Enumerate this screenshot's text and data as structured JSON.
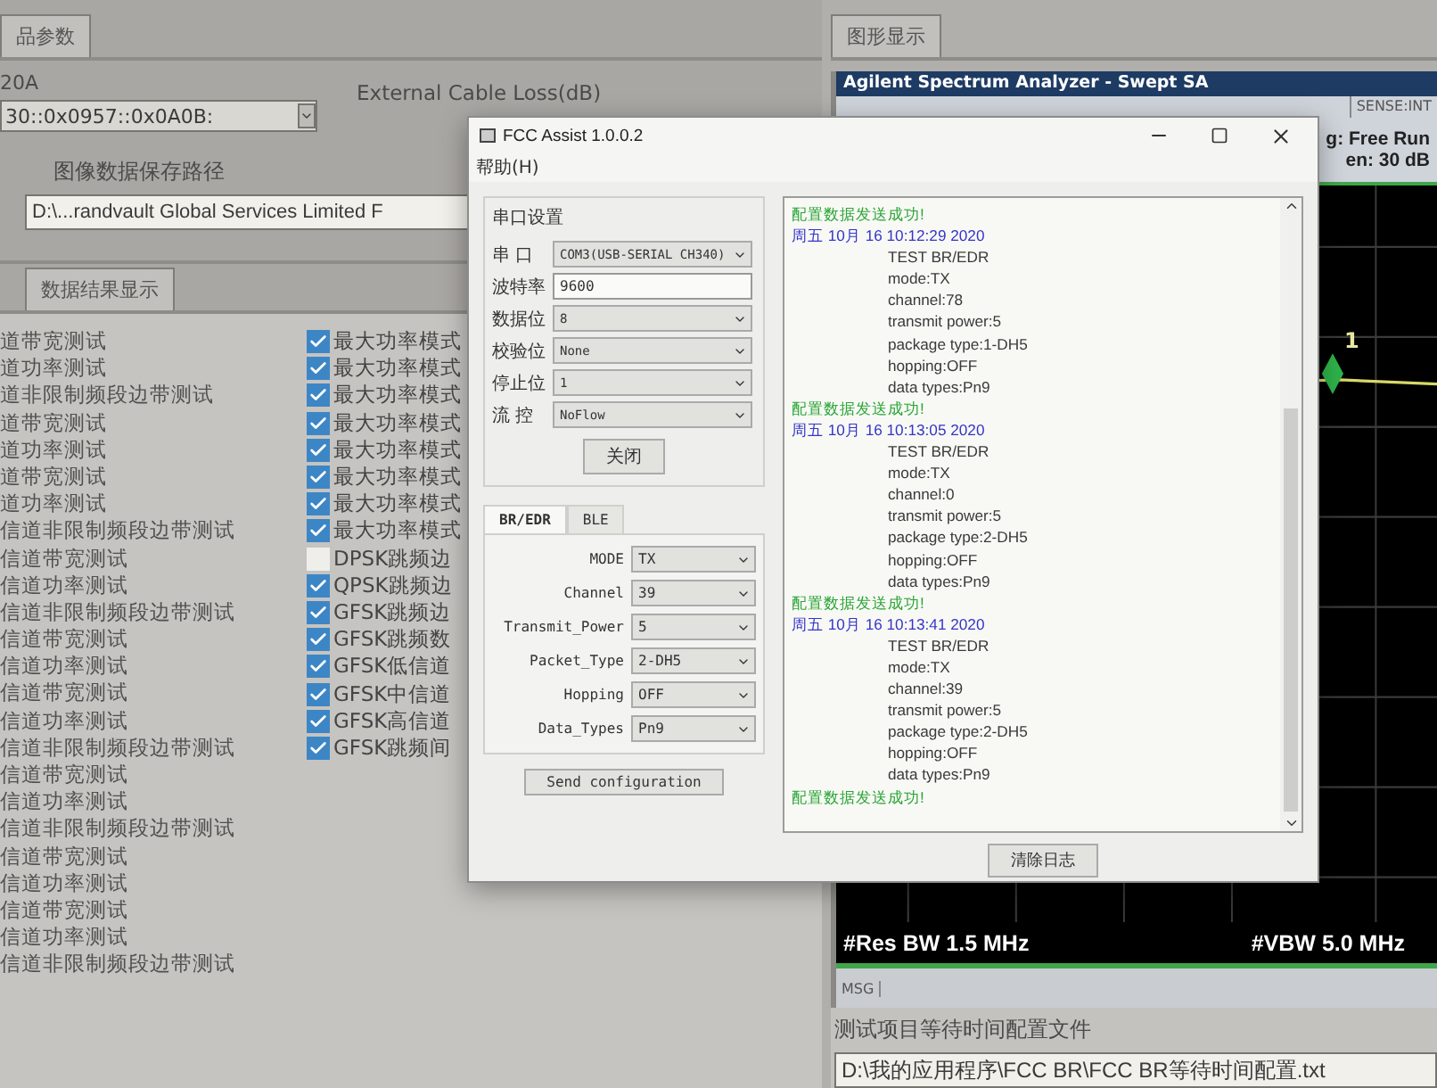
{
  "main_window": {
    "left_tab": "品参数",
    "device_id": "20A",
    "address_combo": "30::0x0957::0x0A0B:",
    "cable_loss_label": "External Cable Loss(dB)",
    "image_path_label": "图像数据保存路径",
    "image_path": "D:\\...randvault Global Services Limited F",
    "results_tab": "数据结果显示",
    "test_items": [
      "道带宽测试",
      "道功率测试",
      "道非限制频段边带测试",
      "道带宽测试",
      "道功率测试",
      "道带宽测试",
      "道功率测试",
      "信道非限制频段边带测试",
      "信道带宽测试",
      "信道功率测试",
      "信道非限制频段边带测试",
      "信道带宽测试",
      "信道功率测试",
      "信道带宽测试",
      "信道功率测试",
      "信道非限制频段边带测试",
      "信道带宽测试",
      "信道功率测试",
      "信道非限制频段边带测试",
      "信道带宽测试",
      "信道功率测试",
      "信道带宽测试",
      "信道功率测试",
      "信道非限制频段边带测试"
    ],
    "modes": [
      {
        "label": "最大功率模式",
        "checked": true
      },
      {
        "label": "最大功率模式",
        "checked": true
      },
      {
        "label": "最大功率模式",
        "checked": true
      },
      {
        "label": "最大功率模式",
        "checked": true
      },
      {
        "label": "最大功率模式",
        "checked": true
      },
      {
        "label": "最大功率模式",
        "checked": true
      },
      {
        "label": "最大功率模式",
        "checked": true
      },
      {
        "label": "最大功率模式",
        "checked": true
      },
      {
        "label": "DPSK跳频边",
        "checked": false
      },
      {
        "label": "QPSK跳频边",
        "checked": true
      },
      {
        "label": "GFSK跳频边",
        "checked": true
      },
      {
        "label": "GFSK跳频数",
        "checked": true
      },
      {
        "label": "GFSK低信道",
        "checked": true
      },
      {
        "label": "GFSK中信道",
        "checked": true
      },
      {
        "label": "GFSK高信道",
        "checked": true
      },
      {
        "label": "GFSK跳频间",
        "checked": true
      }
    ],
    "graph_tab": "图形显示",
    "analyzer": {
      "title": "Agilent Spectrum Analyzer - Swept SA",
      "sense": "SENSE:INT",
      "trigger": "g: Free Run",
      "atten": "en: 30 dB",
      "marker": "1",
      "res_bw": "#Res BW 1.5 MHz",
      "vbw": "#VBW 5.0 MHz",
      "msg": "MSG"
    },
    "wait_config_label": "测试项目等待时间配置文件",
    "wait_config_path": "D:\\我的应用程序\\FCC BR\\FCC BR等待时间配置.txt"
  },
  "dialog": {
    "title": "FCC Assist 1.0.0.2",
    "menu": "帮助(H)",
    "serial_group": "串口设置",
    "serial_fields": [
      {
        "kind": "select",
        "label": "串 口",
        "value": "COM3(USB-SERIAL CH340)"
      },
      {
        "kind": "input",
        "label": "波特率",
        "value": "9600"
      },
      {
        "kind": "select",
        "label": "数据位",
        "value": "8"
      },
      {
        "kind": "select",
        "label": "校验位",
        "value": "None"
      },
      {
        "kind": "select",
        "label": "停止位",
        "value": "1"
      },
      {
        "kind": "select",
        "label": "流 控",
        "value": "NoFlow"
      }
    ],
    "close_button": "关闭",
    "tabs": [
      {
        "label": "BR/EDR",
        "selected": true
      },
      {
        "label": "BLE",
        "selected": false
      }
    ],
    "config_fields": [
      {
        "label": "MODE",
        "value": "TX"
      },
      {
        "label": "Channel",
        "value": "39"
      },
      {
        "label": "Transmit_Power",
        "value": "5"
      },
      {
        "label": "Packet_Type",
        "value": "2-DH5"
      },
      {
        "label": "Hopping",
        "value": "OFF"
      },
      {
        "label": "Data_Types",
        "value": "Pn9"
      }
    ],
    "send_button": "Send configuration",
    "log": [
      {
        "kind": "success",
        "text": "配置数据发送成功!"
      },
      {
        "kind": "timestamp",
        "text": "周五 10月 16 10:12:29 2020"
      },
      {
        "kind": "detail",
        "text": "TEST BR/EDR"
      },
      {
        "kind": "detail",
        "text": "mode:TX"
      },
      {
        "kind": "detail",
        "text": "channel:78"
      },
      {
        "kind": "detail",
        "text": "transmit power:5"
      },
      {
        "kind": "detail",
        "text": "package type:1-DH5"
      },
      {
        "kind": "detail",
        "text": "hopping:OFF"
      },
      {
        "kind": "detail",
        "text": "data types:Pn9"
      },
      {
        "kind": "success",
        "text": "配置数据发送成功!"
      },
      {
        "kind": "timestamp",
        "text": "周五 10月 16 10:13:05 2020"
      },
      {
        "kind": "detail",
        "text": "TEST BR/EDR"
      },
      {
        "kind": "detail",
        "text": "mode:TX"
      },
      {
        "kind": "detail",
        "text": "channel:0"
      },
      {
        "kind": "detail",
        "text": "transmit power:5"
      },
      {
        "kind": "detail",
        "text": "package type:2-DH5"
      },
      {
        "kind": "detail",
        "text": "hopping:OFF"
      },
      {
        "kind": "detail",
        "text": "data types:Pn9"
      },
      {
        "kind": "success",
        "text": "配置数据发送成功!"
      },
      {
        "kind": "timestamp",
        "text": "周五 10月 16 10:13:41 2020"
      },
      {
        "kind": "detail",
        "text": "TEST BR/EDR"
      },
      {
        "kind": "detail",
        "text": "mode:TX"
      },
      {
        "kind": "detail",
        "text": "channel:39"
      },
      {
        "kind": "detail",
        "text": "transmit power:5"
      },
      {
        "kind": "detail",
        "text": "package type:2-DH5"
      },
      {
        "kind": "detail",
        "text": "hopping:OFF"
      },
      {
        "kind": "detail",
        "text": "data types:Pn9"
      },
      {
        "kind": "success",
        "text": "配置数据发送成功!"
      }
    ],
    "clear_button": "清除日志"
  }
}
